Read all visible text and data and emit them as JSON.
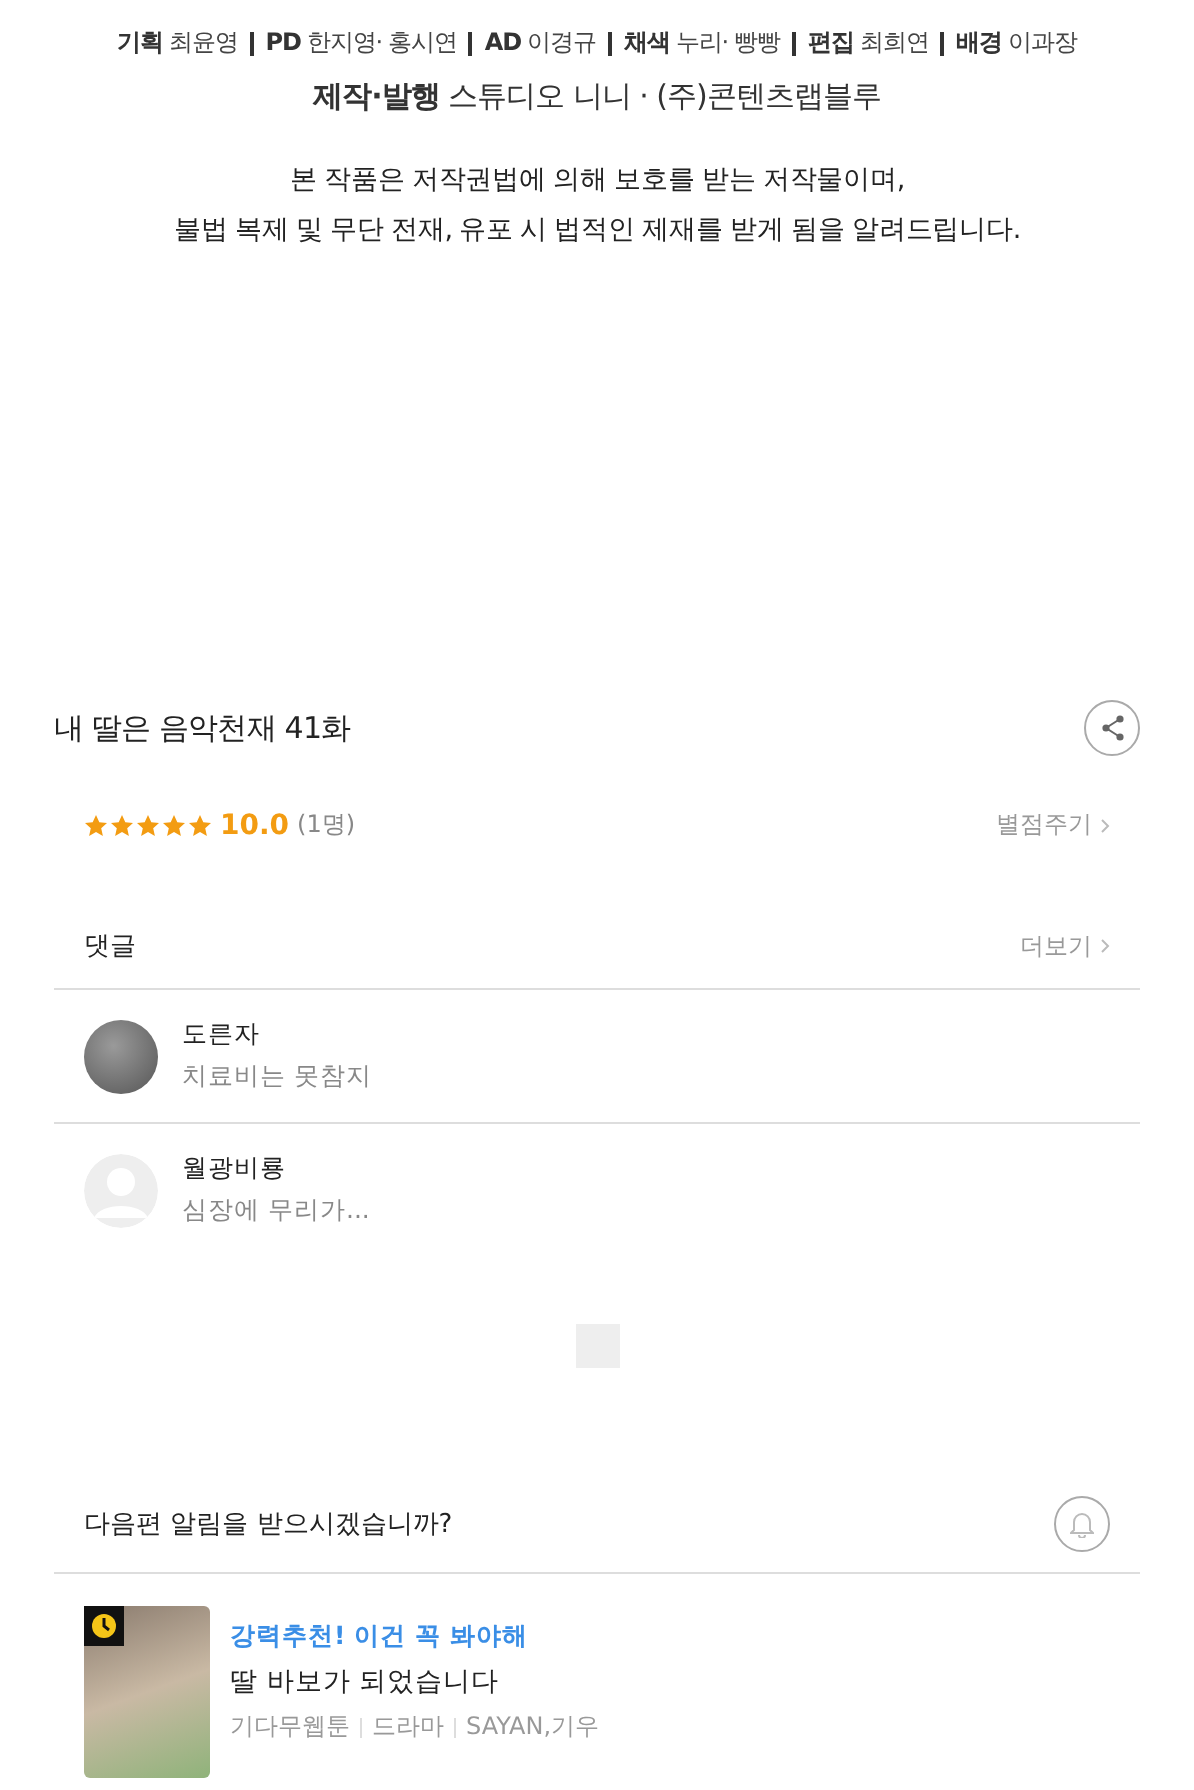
{
  "credits": [
    {
      "role": "기획",
      "names": "최윤영"
    },
    {
      "role": "PD",
      "names": "한지영· 홍시연"
    },
    {
      "role": "AD",
      "names": "이경규"
    },
    {
      "role": "채색",
      "names": "누리· 빵빵"
    },
    {
      "role": "편집",
      "names": "최희연"
    },
    {
      "role": "배경",
      "names": "이과장"
    }
  ],
  "production": "**제작·발행** 스튜디오 니니 · (주)콘텐츠랩블루",
  "notice": [
    "본 작품은 저작권법에 의해 보호를 받는 저작물이며,",
    "불법 복제 및 무단 전재, 유포 시 법적인 제재를 받게 됨을 알려드립니다."
  ],
  "episode_title": "내 딸은 음악천재 41화",
  "rating": {
    "stars": 5,
    "score": "10.0",
    "count": "(1명)",
    "rate_link": "별점주기"
  },
  "comments_header": {
    "title": "댓글",
    "more": "더보기"
  },
  "comments": [
    {
      "author": "도른자",
      "text": "치료비는 못참지",
      "kind": "photo"
    },
    {
      "author": "월광비룡",
      "text": "심장에 무리가...",
      "kind": "default"
    }
  ],
  "notify_prompt": "다음편 알림을 받으시겠습니까?",
  "recommendation": {
    "tag": "강력추천! 이건 꼭 봐야해",
    "title": "딸 바보가 되었습니다",
    "meta": [
      "기다무웹툰",
      "드라마",
      "SAYAN,기우"
    ]
  }
}
